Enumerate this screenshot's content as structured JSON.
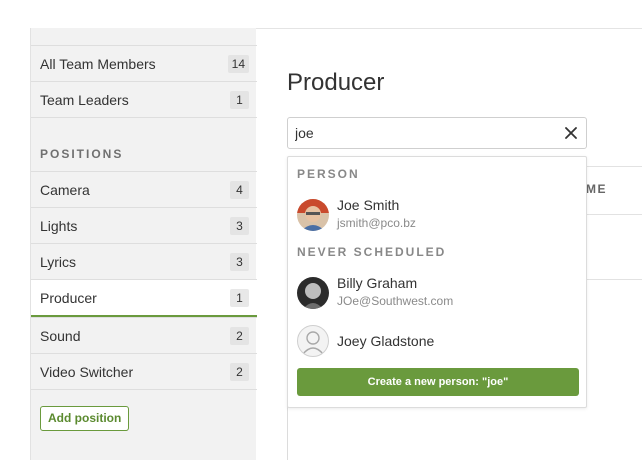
{
  "sidebar": {
    "items": [
      {
        "label": "All Team Members",
        "count": "14"
      },
      {
        "label": "Team Leaders",
        "count": "1"
      }
    ],
    "section_header": "POSITIONS",
    "positions": [
      {
        "label": "Camera",
        "count": "4"
      },
      {
        "label": "Lights",
        "count": "3"
      },
      {
        "label": "Lyrics",
        "count": "3"
      },
      {
        "label": "Producer",
        "count": "1"
      },
      {
        "label": "Sound",
        "count": "2"
      },
      {
        "label": "Video Switcher",
        "count": "2"
      }
    ],
    "add_position_label": "Add position"
  },
  "main": {
    "title": "Producer",
    "background_column_fragment": "ME"
  },
  "search": {
    "value": "joe",
    "clear_icon": "close-icon"
  },
  "dropdown": {
    "person_header": "PERSON",
    "person": {
      "name": "Joe Smith",
      "email": "jsmith@pco.bz"
    },
    "never_header": "NEVER SCHEDULED",
    "never": [
      {
        "name": "Billy Graham",
        "email": "JOe@Southwest.com"
      },
      {
        "name": "Joey Gladstone",
        "email": ""
      }
    ],
    "create_label": "Create a new person: \"joe\""
  },
  "colors": {
    "accent": "#6a9a3d",
    "sidebar_bg": "#f2f2f2"
  }
}
